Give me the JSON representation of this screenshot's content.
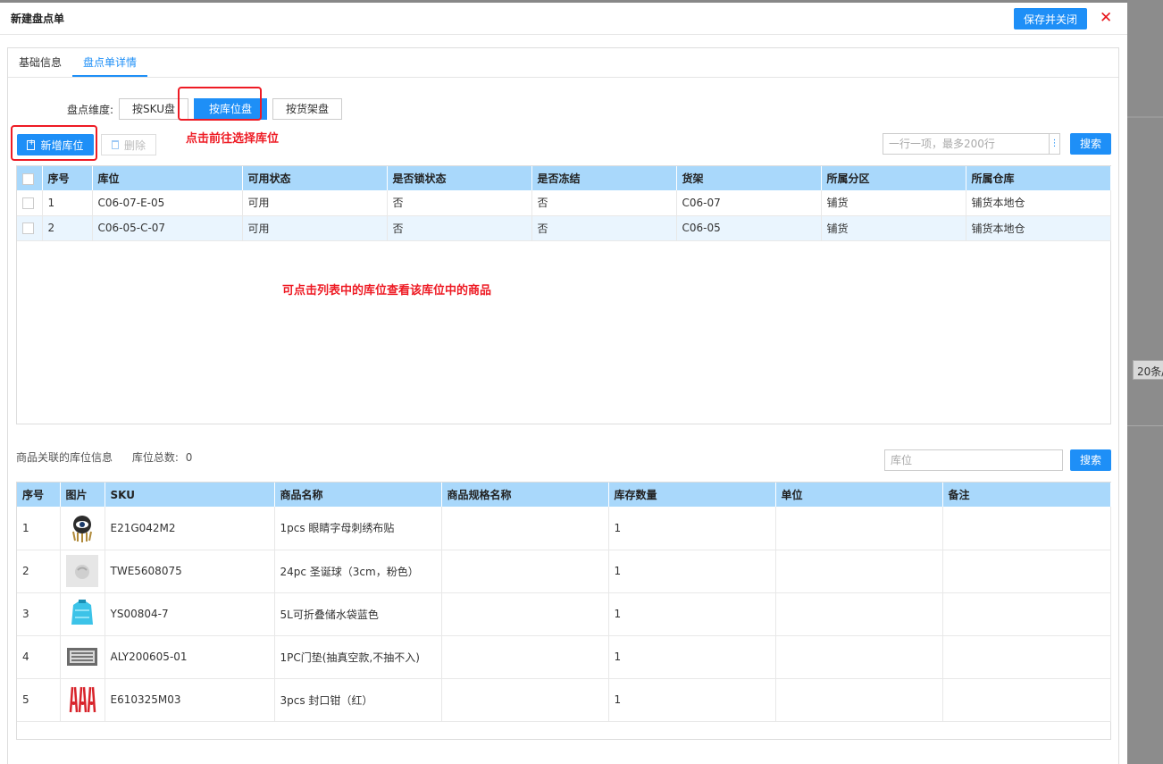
{
  "modal": {
    "title": "新建盘点单",
    "save_close_label": "保存并关闭",
    "close_glyph": "✕"
  },
  "tabs": [
    {
      "label": "基础信息",
      "active": false
    },
    {
      "label": "盘点单详情",
      "active": true
    }
  ],
  "dimension": {
    "label": "盘点维度:",
    "options": [
      {
        "label": "按SKU盘",
        "active": false
      },
      {
        "label": "按库位盘",
        "active": true
      },
      {
        "label": "按货架盘",
        "active": false
      }
    ]
  },
  "toolbar": {
    "add_label": "新增库位",
    "delete_label": "删除",
    "search_placeholder": "一行一项，最多200行",
    "search_label": "搜索"
  },
  "annotations": {
    "select_location": "点击前往选择库位",
    "click_location": "可点击列表中的库位查看该库位中的商品"
  },
  "location_table": {
    "headers": [
      "序号",
      "库位",
      "可用状态",
      "是否锁状态",
      "是否冻结",
      "货架",
      "所属分区",
      "所属仓库"
    ],
    "rows": [
      [
        "1",
        "C06-07-E-05",
        "可用",
        "否",
        "否",
        "C06-07",
        "铺货",
        "铺货本地仓"
      ],
      [
        "2",
        "C06-05-C-07",
        "可用",
        "否",
        "否",
        "C06-05",
        "铺货",
        "铺货本地仓"
      ]
    ]
  },
  "product_section": {
    "title": "商品关联的库位信息",
    "count_label": "库位总数:",
    "count": "0",
    "search_placeholder": "库位",
    "search_label": "搜索"
  },
  "product_table": {
    "headers": [
      "序号",
      "图片",
      "SKU",
      "商品名称",
      "商品规格名称",
      "库存数量",
      "单位",
      "备注"
    ],
    "rows": [
      {
        "no": "1",
        "image": "eye-patch-icon",
        "sku": "E21G042M2",
        "name": "1pcs 眼睛字母刺绣布贴",
        "spec": "",
        "qty": "1",
        "unit": "",
        "note": ""
      },
      {
        "no": "2",
        "image": "ornament-ball-icon",
        "sku": "TWE5608075",
        "name": "24pc 圣诞球（3cm，粉色）",
        "spec": "",
        "qty": "1",
        "unit": "",
        "note": ""
      },
      {
        "no": "3",
        "image": "water-bag-icon",
        "sku": "YS00804-7",
        "name": "5L可折叠储水袋蓝色",
        "spec": "",
        "qty": "1",
        "unit": "",
        "note": ""
      },
      {
        "no": "4",
        "image": "door-mat-icon",
        "sku": "ALY200605-01",
        "name": "1PC门垫(抽真空款,不抽不入)",
        "spec": "",
        "qty": "1",
        "unit": "",
        "note": ""
      },
      {
        "no": "5",
        "image": "sealing-clip-icon",
        "sku": "E610325M03",
        "name": "3pcs 封口钳（红）",
        "spec": "",
        "qty": "1",
        "unit": "",
        "note": ""
      }
    ]
  },
  "background": {
    "pager_text": "20条/"
  },
  "colors": {
    "primary": "#1e8ff7",
    "header_bg": "#a9d8fb",
    "annotation": "#ee1b24"
  }
}
